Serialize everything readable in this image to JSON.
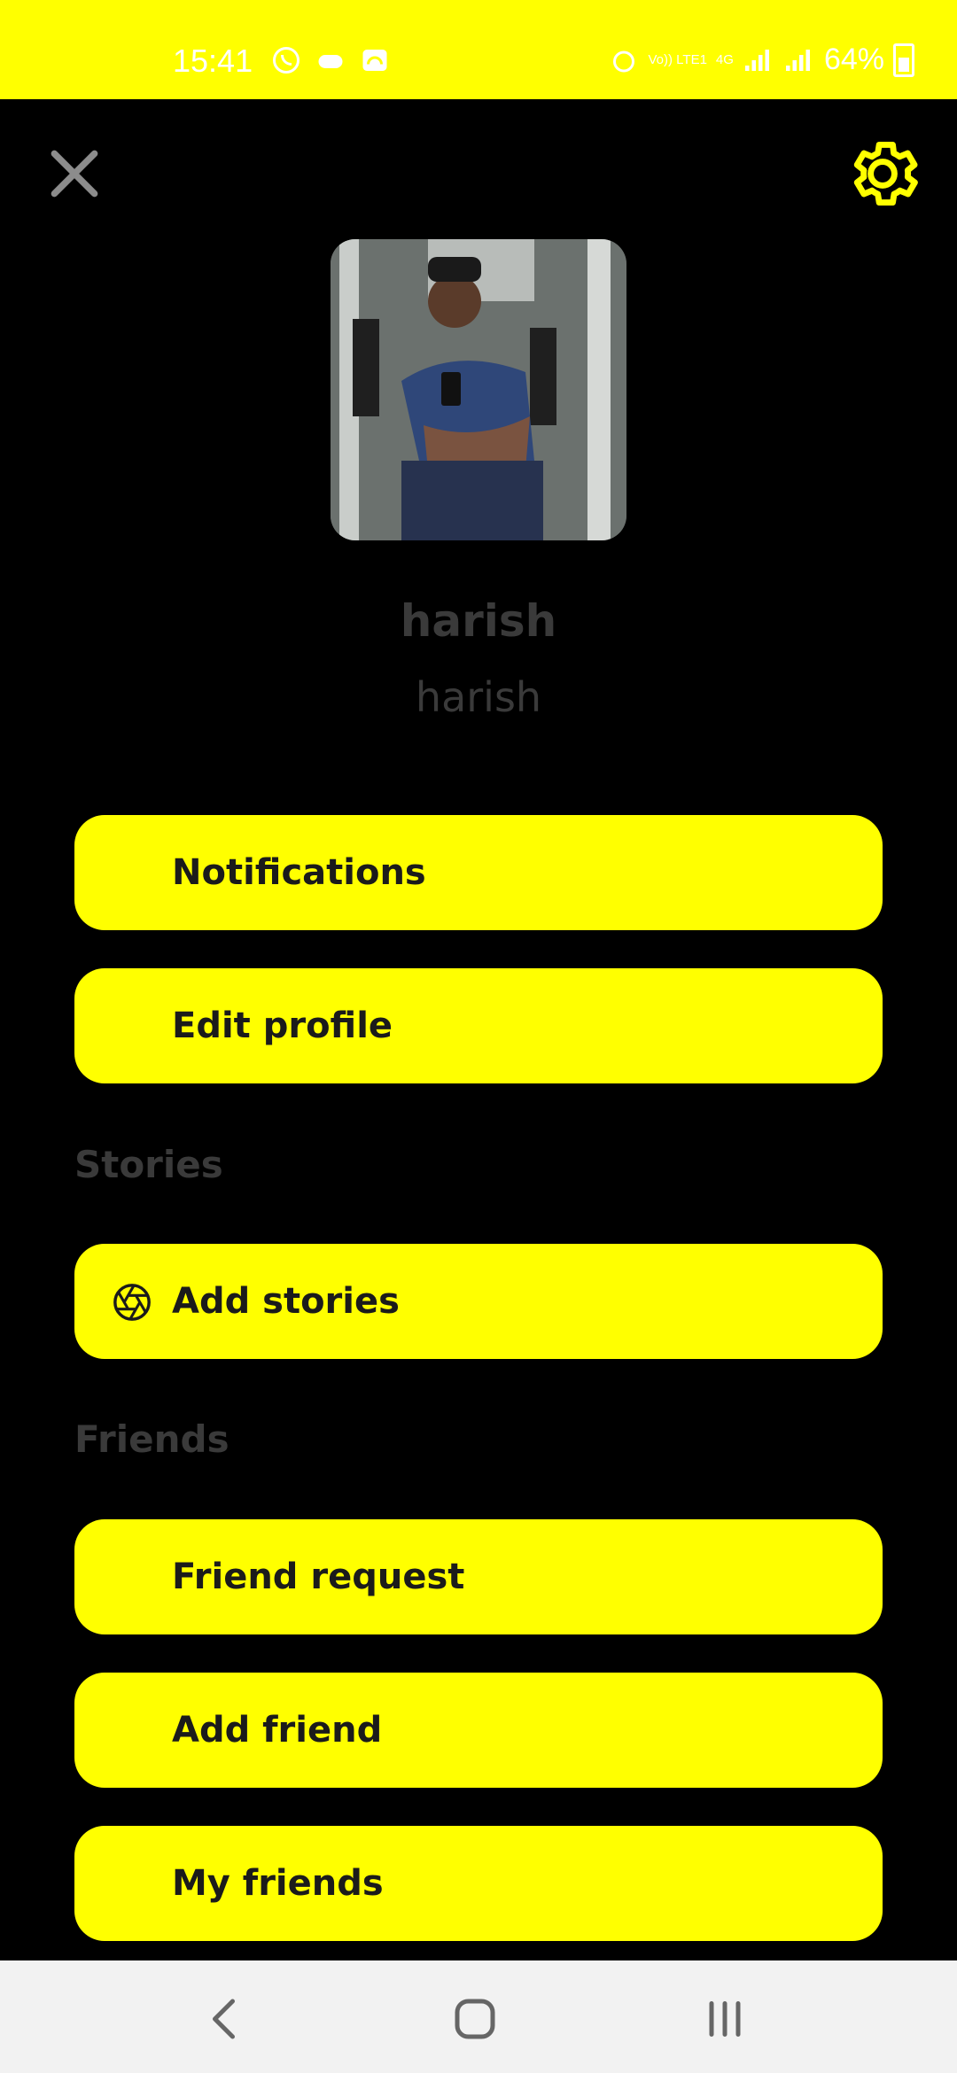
{
  "colors": {
    "accent": "#FFFF00",
    "background": "#000000",
    "muted_text": "#3a3a3a",
    "button_text": "#1b1b1b"
  },
  "status_bar": {
    "time": "15:41",
    "left_icons": [
      "whatsapp-icon",
      "game-icon",
      "cast-icon"
    ],
    "right_small_1": "Vo)) LTE1",
    "right_small_2": "4G",
    "battery": "64%"
  },
  "header": {
    "close_icon": "close-icon",
    "settings_icon": "gear-icon"
  },
  "profile": {
    "display_name": "harish",
    "username": "harish"
  },
  "menu": {
    "notifications": "Notifications",
    "edit_profile": "Edit profile",
    "stories_section": "Stories",
    "add_stories": "Add stories",
    "friends_section": "Friends",
    "friend_request": "Friend request",
    "add_friend": "Add friend",
    "my_friends": "My friends"
  },
  "nav": {
    "back": "back-icon",
    "home": "home-icon",
    "recents": "recents-icon"
  }
}
